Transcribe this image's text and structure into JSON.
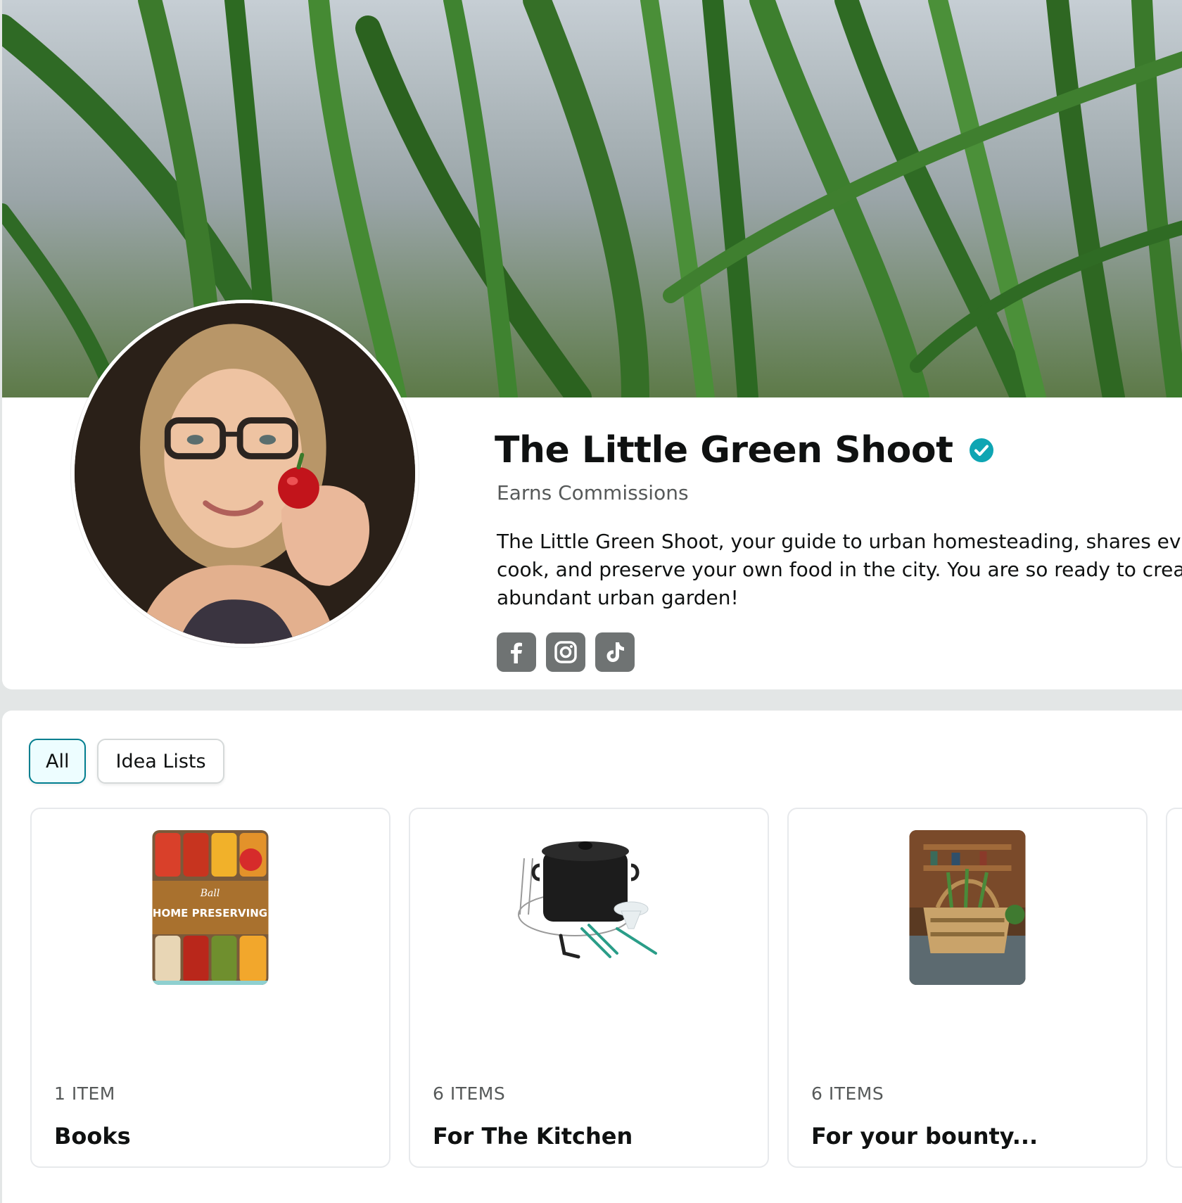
{
  "profile": {
    "name": "The Little Green Shoot",
    "subtitle": "Earns Commissions",
    "bio_lines": [
      "The Little Green Shoot, your guide to urban homesteading, shares every",
      "cook, and preserve your own food in the city. You are so ready to create",
      "abundant urban garden!"
    ],
    "verified_icon": "verified-check-icon",
    "accent_color": "#0ea5b3"
  },
  "socials": [
    {
      "icon": "facebook-icon"
    },
    {
      "icon": "instagram-icon"
    },
    {
      "icon": "tiktok-icon"
    }
  ],
  "filters": [
    {
      "label": "All",
      "active": true
    },
    {
      "label": "Idea Lists",
      "active": false
    }
  ],
  "lists": [
    {
      "count": "1 ITEM",
      "title": "Books",
      "image": "home-preserving-book-cover"
    },
    {
      "count": "6 ITEMS",
      "title": "For The Kitchen",
      "image": "canning-pot-set"
    },
    {
      "count": "6 ITEMS",
      "title": "For your bounty...",
      "image": "garden-harvest-basket"
    }
  ],
  "book_cover": {
    "title": "HOME PRESERVING",
    "brand": "Ball"
  }
}
